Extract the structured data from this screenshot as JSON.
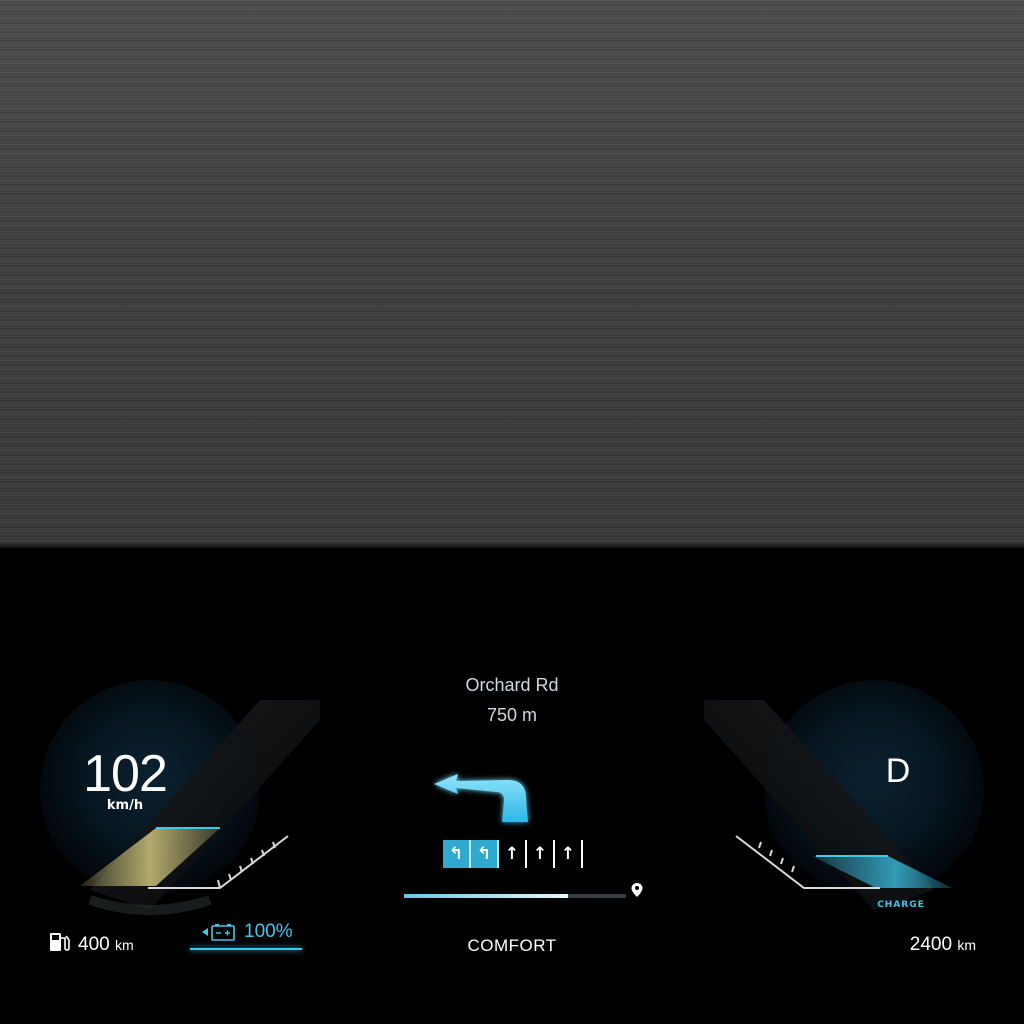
{
  "navigation": {
    "street": "Orchard Rd",
    "distance": "750 m",
    "turn_direction": "left",
    "route_progress": 0.74,
    "lanes": [
      {
        "icon": "arrow-turn-left",
        "glyph": "↰",
        "active": true
      },
      {
        "icon": "arrow-turn-left",
        "glyph": "↰",
        "active": true
      },
      {
        "icon": "arrow-straight",
        "glyph": "↑",
        "active": false
      },
      {
        "icon": "arrow-straight",
        "glyph": "↑",
        "active": false
      },
      {
        "icon": "arrow-straight",
        "glyph": "↑",
        "active": false
      }
    ]
  },
  "speedometer": {
    "speed": "102",
    "unit": "km/h"
  },
  "gear_display": {
    "gear": "D",
    "charge_label": "CHARGE"
  },
  "status_bar": {
    "fuel_range_value": "400",
    "fuel_range_unit": "km",
    "battery_percent": "100%",
    "drive_mode": "COMFORT",
    "total_range_value": "2400",
    "total_range_unit": "km"
  },
  "colors": {
    "accent": "#3ec8ee",
    "speed_band": "#e8dc8a",
    "background": "#000000"
  }
}
